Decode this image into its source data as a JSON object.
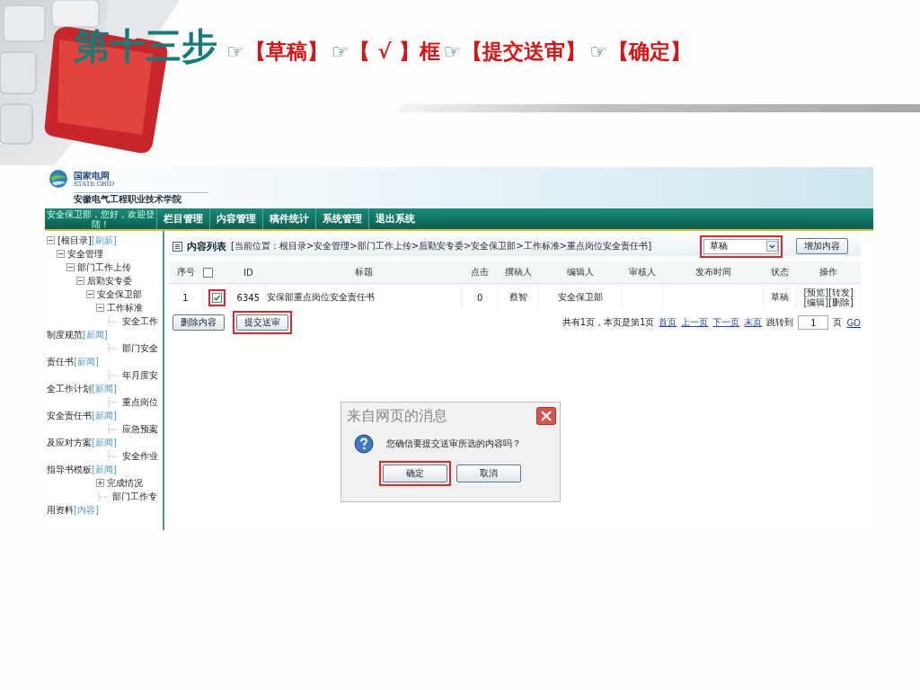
{
  "slide": {
    "title": "第十三步",
    "steps": [
      {
        "pointer": "☞",
        "text": "【草稿】"
      },
      {
        "pointer": "☞",
        "text": "【 √ 】框"
      },
      {
        "pointer": "☞",
        "text": "【提交送审】"
      },
      {
        "pointer": "☞",
        "text": "【确定】"
      }
    ]
  },
  "app": {
    "header": {
      "logo_title": "国家电网",
      "logo_subtitle": "STATE GRID",
      "school": "安徽电气工程职业技术学院"
    },
    "nav": {
      "greeting": "安全保卫部，您好，欢迎登陆！",
      "items": [
        "栏目管理",
        "内容管理",
        "稿件统计",
        "系统管理",
        "退出系统"
      ]
    },
    "sidebar": {
      "tree": [
        {
          "label": "[根目录]",
          "tag": "[刷新]",
          "expanded": true,
          "children": [
            {
              "label": "安全管理",
              "expanded": true,
              "children": [
                {
                  "label": "部门工作上传",
                  "expanded": true,
                  "children": [
                    {
                      "label": "后勤安专委",
                      "expanded": true,
                      "children": [
                        {
                          "label": "安全保卫部",
                          "expanded": true,
                          "children": [
                            {
                              "label": "工作标准",
                              "expanded": true,
                              "children": [
                                {
                                  "label": "安全工作制度规范",
                                  "tag": "[新闻]"
                                },
                                {
                                  "label": "部门安全责任书",
                                  "tag": "[新闻]"
                                },
                                {
                                  "label": "年月度安全工作计划",
                                  "tag": "[新闻]"
                                },
                                {
                                  "label": "重点岗位安全责任书",
                                  "tag": "[新闻]"
                                },
                                {
                                  "label": "应急预案及应对方案",
                                  "tag": "[新闻]"
                                },
                                {
                                  "label": "安全作业指导书模板",
                                  "tag": "[新闻]"
                                }
                              ]
                            },
                            {
                              "label": "完成情况",
                              "expanded": false
                            },
                            {
                              "label": "部门工作专用资料",
                              "tag": "[内容]"
                            }
                          ]
                        }
                      ]
                    }
                  ]
                }
              ]
            }
          ]
        }
      ]
    },
    "content": {
      "title": "内容列表",
      "breadcrumb": "[当前位置：根目录>安全管理>部门工作上传>后勤安专委>安全保卫部>工作标准>重点岗位安全责任书]",
      "status_filter": {
        "value": "草稿",
        "highlighted": true
      },
      "add_button": "增加内容",
      "table": {
        "columns": [
          {
            "kind": "text",
            "label": "序号"
          },
          {
            "kind": "checkbox",
            "checked": false
          },
          {
            "kind": "text",
            "label": "ID"
          },
          {
            "kind": "text",
            "label": "标题"
          },
          {
            "kind": "text",
            "label": "点击"
          },
          {
            "kind": "text",
            "label": "撰稿人"
          },
          {
            "kind": "text",
            "label": "编辑人"
          },
          {
            "kind": "text",
            "label": "审核人"
          },
          {
            "kind": "text",
            "label": "发布时间"
          },
          {
            "kind": "text",
            "label": "状态"
          },
          {
            "kind": "text",
            "label": "操作"
          }
        ],
        "rows": [
          {
            "cells": [
              {
                "kind": "text",
                "text": "1"
              },
              {
                "kind": "checkbox",
                "checked": true,
                "highlighted": true
              },
              {
                "kind": "text",
                "text": "6345"
              },
              {
                "kind": "title",
                "text": "安保部重点岗位安全责任书"
              },
              {
                "kind": "text",
                "text": "0"
              },
              {
                "kind": "text",
                "text": "蔡智"
              },
              {
                "kind": "text",
                "text": "安全保卫部"
              },
              {
                "kind": "blank"
              },
              {
                "kind": "blank"
              },
              {
                "kind": "text",
                "text": "草稿"
              },
              {
                "kind": "actions",
                "links": [
                  "[预览]",
                  "[转发]",
                  "[编辑]",
                  "[删除]"
                ]
              }
            ]
          }
        ]
      },
      "buttons": [
        {
          "label": "删除内容",
          "highlighted": false
        },
        {
          "label": "提交送审",
          "highlighted": true
        }
      ],
      "pagination": {
        "summary": "共有1页，本页是第1页",
        "links": [
          "首页",
          "上一页",
          "下一页",
          "末页"
        ],
        "jump_label": "跳转到",
        "page_input": "1",
        "page_unit": "页",
        "go": "GO"
      }
    },
    "dialog": {
      "title": "来自网页的消息",
      "message": "您确信要提交送审所选的内容吗？",
      "buttons": [
        {
          "label": "确定",
          "highlighted": true
        },
        {
          "label": "取消",
          "highlighted": false
        }
      ]
    }
  }
}
